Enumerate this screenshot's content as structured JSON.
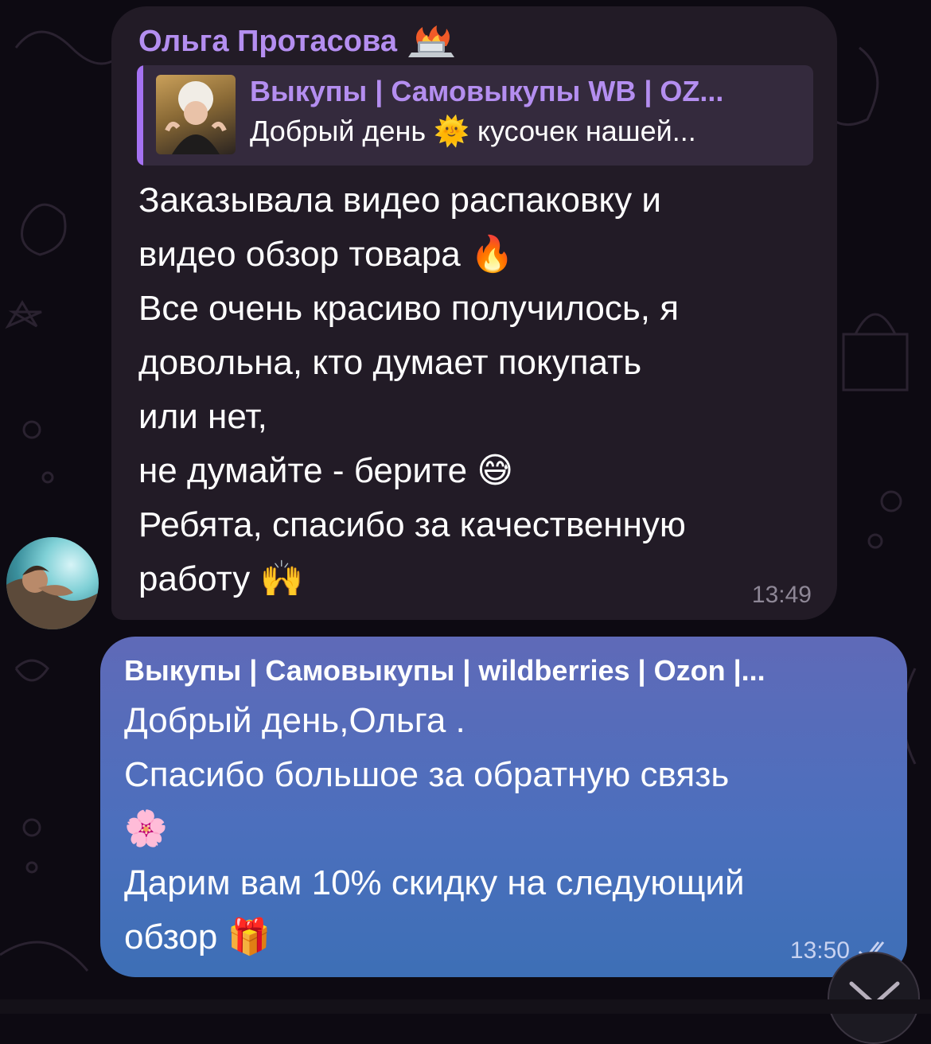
{
  "incoming": {
    "sender": "Ольга Протасова",
    "reply": {
      "title": "Выкупы | Самовыкупы WB | OZ...",
      "text": "Добрый день 🌞 кусочек нашей..."
    },
    "lines": [
      "Заказывала видео распаковку и",
      "видео обзор товара 🔥",
      "Все очень красиво получилось, я",
      "довольна, кто думает покупать",
      "или нет,",
      "не думайте - берите 😅",
      "Ребята, спасибо за качественную",
      "работу 🙌"
    ],
    "time": "13:49"
  },
  "outgoing": {
    "sender": "Выкупы | Самовыкупы | wildberries | Ozon |...",
    "lines": [
      "Добрый день,Ольга .",
      "Спасибо большое за обратную связь",
      "🌸",
      "Дарим вам 10% скидку на следующий",
      "обзор 🎁"
    ],
    "time": "13:50"
  },
  "colors": {
    "incoming_bubble": "#221b26",
    "sender_accent": "#b48ef0",
    "outgoing_bubble": "#4c6fbd"
  },
  "icons": {
    "sender_badge": "laptop-fire-icon",
    "read_status": "double-check-icon",
    "scroll_down": "chevron-down-icon"
  }
}
